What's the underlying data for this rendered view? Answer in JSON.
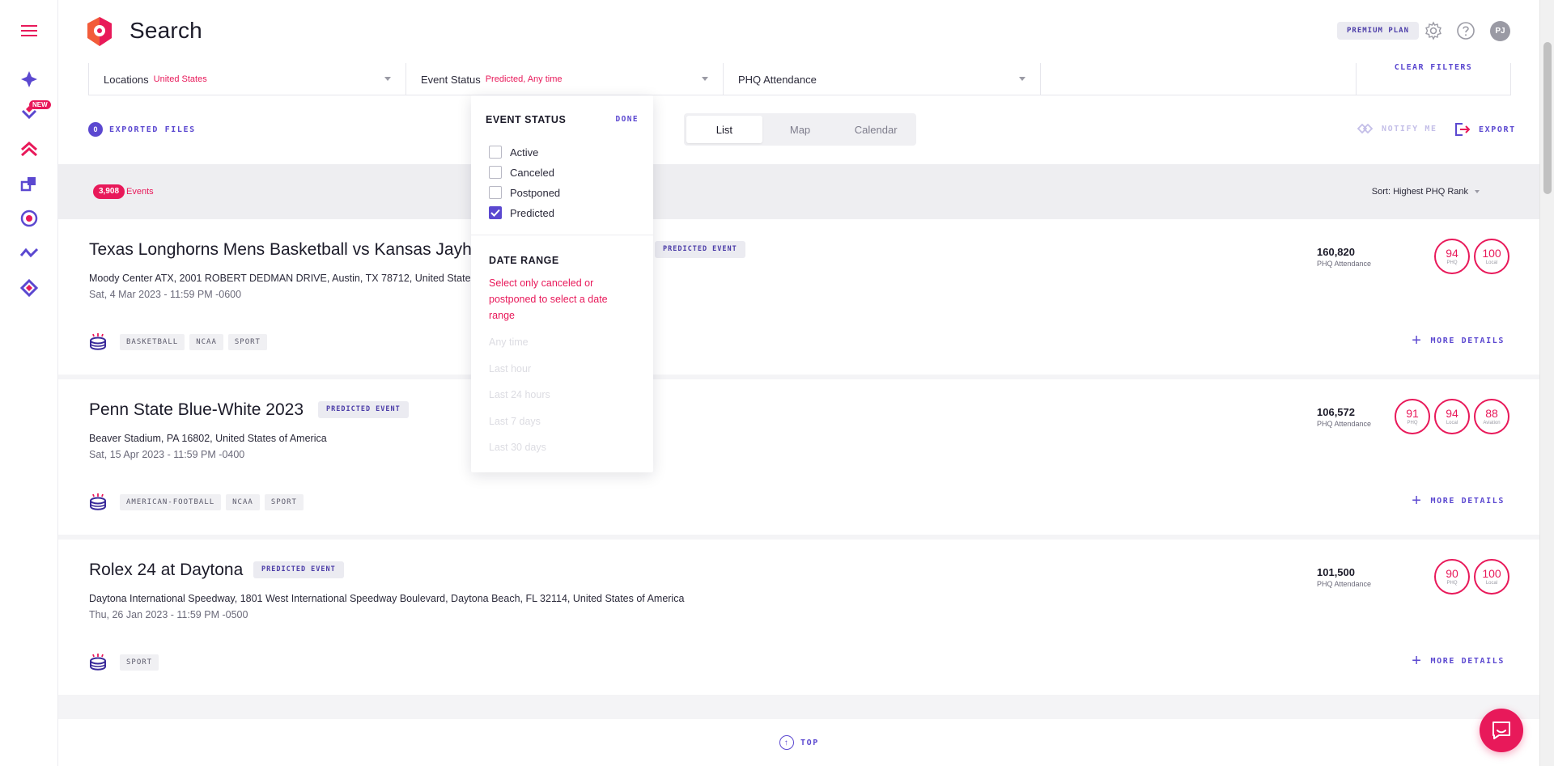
{
  "header": {
    "title": "Search",
    "plan": "PREMIUM PLAN",
    "avatar_initials": "PJ"
  },
  "sidebar": {
    "new_badge": "NEW",
    "items": [
      "discover-icon",
      "new-feature-icon",
      "rank-icon",
      "copy-icon",
      "target-icon",
      "trend-icon",
      "diamond-icon"
    ]
  },
  "filters": {
    "locations": {
      "label": "Locations",
      "value": "United States"
    },
    "event_status": {
      "label": "Event Status",
      "value": "Predicted, Any time"
    },
    "attendance": {
      "label": "PHQ Attendance",
      "value": ""
    },
    "clear": "CLEAR FILTERS"
  },
  "toolbar": {
    "exported_count": "0",
    "exported_label": "EXPORTED FILES",
    "views": [
      "List",
      "Map",
      "Calendar"
    ],
    "active_view": "List",
    "notify": "NOTIFY ME",
    "export": "EXPORT"
  },
  "results": {
    "count": "3,908",
    "label": "Events",
    "sort": "Sort: Highest PHQ Rank"
  },
  "events": [
    {
      "title": "Texas Longhorns Mens Basketball vs Kansas Jayh",
      "badge": "PREDICTED EVENT",
      "address": "Moody Center ATX, 2001 ROBERT DEDMAN DRIVE, Austin, TX 78712, United States",
      "date": "Sat, 4 Mar 2023 - 11:59 PM -0600",
      "tags": [
        "BASKETBALL",
        "NCAA",
        "SPORT"
      ],
      "attendance": "160,820",
      "attendance_label": "PHQ Attendance",
      "ranks": [
        {
          "value": "94",
          "label": "PHQ"
        },
        {
          "value": "100",
          "label": "Local"
        }
      ],
      "more": "MORE DETAILS"
    },
    {
      "title": "Penn State Blue-White 2023",
      "badge": "PREDICTED EVENT",
      "address": "Beaver Stadium, PA 16802, United States of America",
      "date": "Sat, 15 Apr 2023 - 11:59 PM -0400",
      "tags": [
        "AMERICAN-FOOTBALL",
        "NCAA",
        "SPORT"
      ],
      "attendance": "106,572",
      "attendance_label": "PHQ Attendance",
      "ranks": [
        {
          "value": "91",
          "label": "PHQ"
        },
        {
          "value": "94",
          "label": "Local"
        },
        {
          "value": "88",
          "label": "Aviation"
        }
      ],
      "more": "MORE DETAILS"
    },
    {
      "title": "Rolex 24 at Daytona",
      "badge": "PREDICTED EVENT",
      "address": "Daytona International Speedway, 1801 West International Speedway Boulevard, Daytona Beach, FL 32114, United States of America",
      "date": "Thu, 26 Jan 2023 - 11:59 PM -0500",
      "tags": [
        "SPORT"
      ],
      "attendance": "101,500",
      "attendance_label": "PHQ Attendance",
      "ranks": [
        {
          "value": "90",
          "label": "PHQ"
        },
        {
          "value": "100",
          "label": "Local"
        }
      ],
      "more": "MORE DETAILS"
    }
  ],
  "popover": {
    "title": "EVENT STATUS",
    "done": "DONE",
    "options": [
      {
        "label": "Active",
        "checked": false
      },
      {
        "label": "Canceled",
        "checked": false
      },
      {
        "label": "Postponed",
        "checked": false
      },
      {
        "label": "Predicted",
        "checked": true
      }
    ],
    "date_title": "DATE RANGE",
    "warning": "Select only canceled or postponed to select a date range",
    "ranges": [
      "Any time",
      "Last hour",
      "Last 24 hours",
      "Last 7 days",
      "Last 30 days"
    ]
  },
  "bottom": {
    "top_label": "TOP"
  },
  "colors": {
    "accent": "#5b48d0",
    "brand": "#e8195a"
  }
}
